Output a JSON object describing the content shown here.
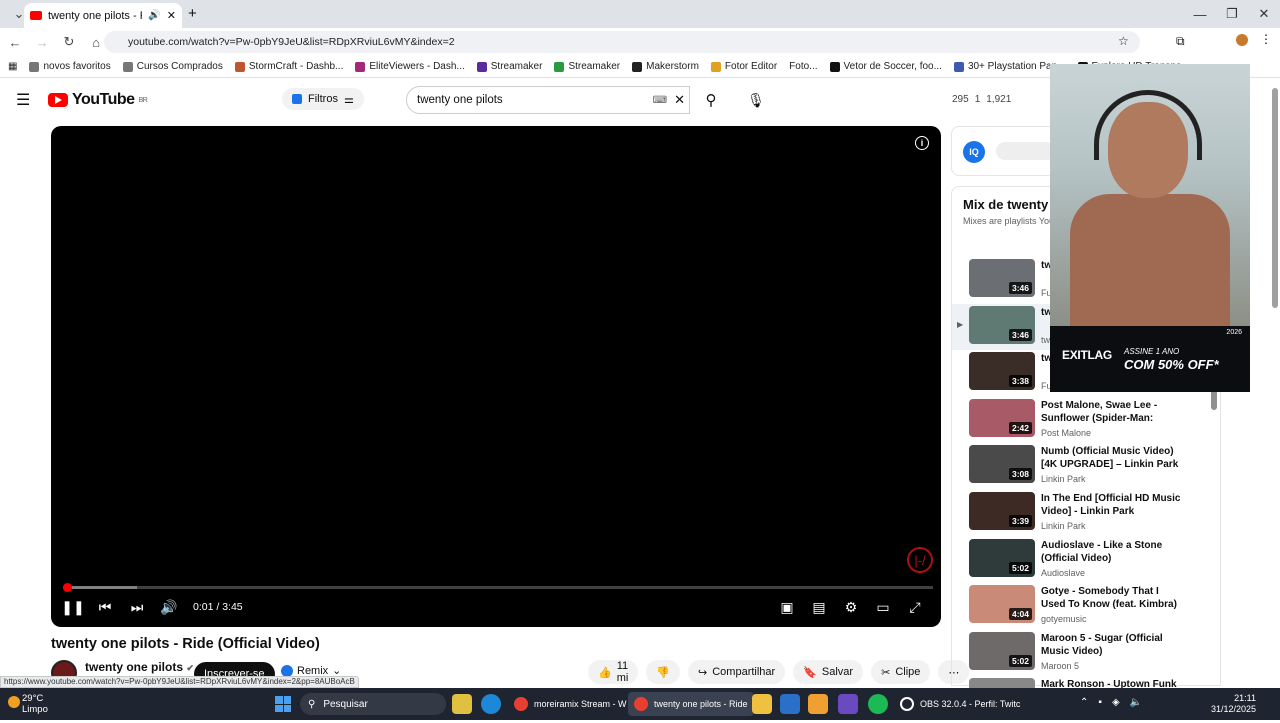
{
  "browser": {
    "tab_title": "twenty one pilots - Ride (O",
    "url": "youtube.com/watch?v=Pw-0pbY9JeU&list=RDpXRviuL6vMY&index=2",
    "bookmarks": [
      "novos favoritos",
      "Cursos Comprados",
      "StormCraft - Dashb...",
      "EliteViewers - Dash...",
      "Streamaker",
      "Streamaker",
      "Makerstorm",
      "Fotor Editor",
      "Foto...",
      "Vetor de Soccer, foo...",
      "30+ Playstation Pap...",
      "Explore HD Transpa..."
    ],
    "window_controls": [
      "—",
      "❐",
      "✕"
    ]
  },
  "youtube": {
    "logo_text": "YouTube",
    "logo_region": "BR",
    "filters_label": "Filtros",
    "search_value": "twenty one pilots",
    "stats": [
      "295",
      "1",
      "1,921"
    ]
  },
  "player": {
    "current_time": "0:01 / 3:45",
    "progress_fraction": 0.005,
    "buffered_fraction": 0.085,
    "info_label": "i",
    "watermark_label": "|-/"
  },
  "video": {
    "title": "twenty one pilots - Ride (Official Video)",
    "channel": "twenty one pilots",
    "subscribe_label": "Inscrever-se",
    "remix_label": "Remix",
    "likes": "11 mi",
    "share_label": "Compartilhar",
    "save_label": "Salvar",
    "clip_label": "Clipe"
  },
  "sidebar": {
    "iq_label": "IQ",
    "mix_title": "Mix de twenty o",
    "mix_subtitle": "Mixes are playlists YouTu",
    "items": [
      {
        "title": "tw [O",
        "channel": "Fue",
        "duration": "3:46",
        "color": "#6b6e73"
      },
      {
        "title": "tw (O",
        "channel": "twe",
        "duration": "3:46",
        "color": "#5e7a73",
        "playing": true
      },
      {
        "title": "tw (fr",
        "channel": "Fue",
        "duration": "3:38",
        "color": "#3a2d28"
      },
      {
        "title": "Post Malone, Swae Lee - Sunflower (Spider-Man: Into...",
        "channel": "Post Malone",
        "duration": "2:42",
        "color": "#a85a66"
      },
      {
        "title": "Numb (Official Music Video) [4K UPGRADE] – Linkin Park",
        "channel": "Linkin Park",
        "duration": "3:08",
        "color": "#4a4a4a"
      },
      {
        "title": "In The End [Official HD Music Video] - Linkin Park",
        "channel": "Linkin Park",
        "duration": "3:39",
        "color": "#3d2a24"
      },
      {
        "title": "Audioslave - Like a Stone (Official Video)",
        "channel": "Audioslave",
        "duration": "5:02",
        "color": "#2e3b3a"
      },
      {
        "title": "Gotye - Somebody That I Used To Know (feat. Kimbra) [Offici...",
        "channel": "gotyemusic",
        "duration": "4:04",
        "color": "#c98b78"
      },
      {
        "title": "Maroon 5 - Sugar (Official Music Video)",
        "channel": "Maroon 5",
        "duration": "5:02",
        "color": "#6f6a6a"
      },
      {
        "title": "Mark Ronson - Uptown Funk",
        "channel": "",
        "duration": "",
        "color": "#888"
      }
    ]
  },
  "ad": {
    "brand": "EXITLAG",
    "line1": "ASSINE 1 ANO",
    "line2": "COM 50% OFF*",
    "badge": "2026"
  },
  "status_url": "https://www.youtube.com/watch?v=Pw-0pbY9JeU&list=RDpXRviuL6vMY&index=2&pp=8AUBoAcB",
  "taskbar": {
    "temp": "29°C",
    "weather": "Limpo",
    "search_label": "Pesquisar",
    "tasks": [
      "moreiramix Stream - W",
      "twenty one pilots - Ride",
      "OBS 32.0.4 - Perfil: Twitc"
    ],
    "time": "21:11",
    "date": "31/12/2025"
  }
}
